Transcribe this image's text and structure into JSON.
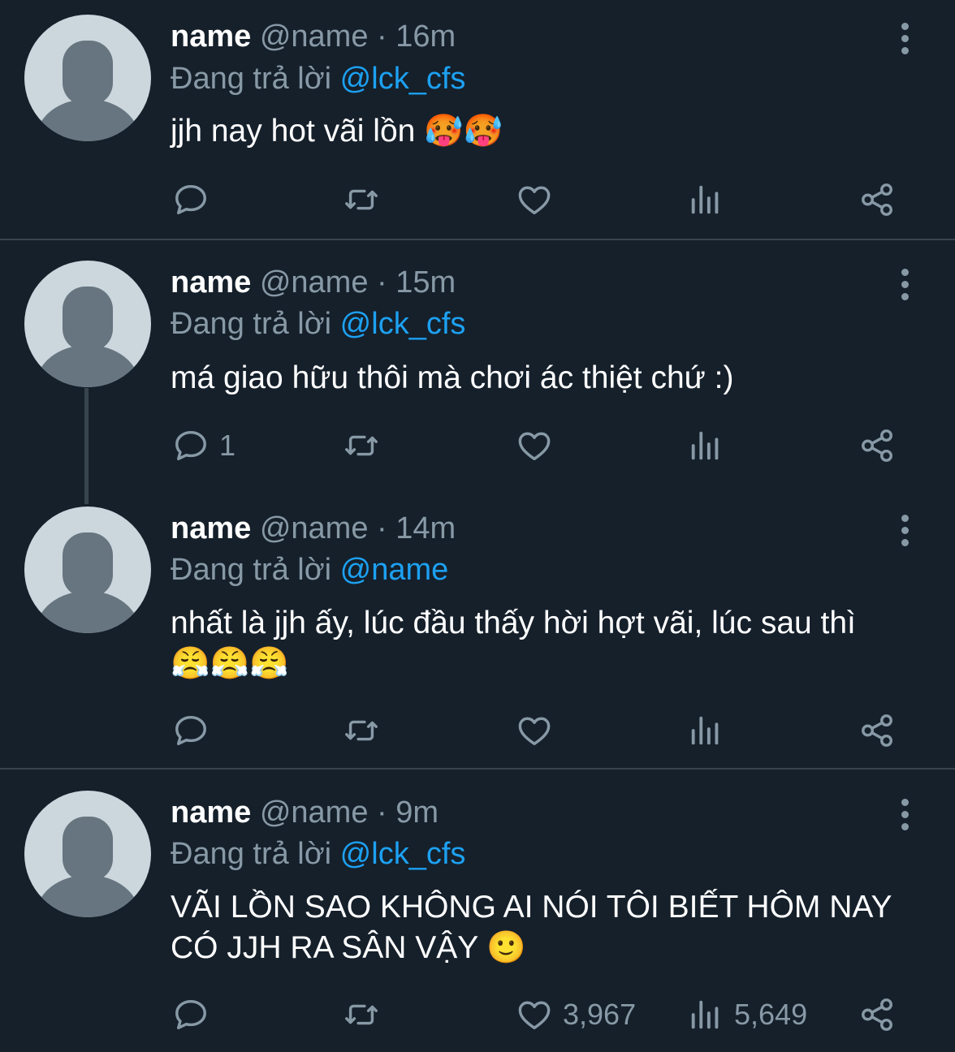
{
  "tweets": [
    {
      "name": "name",
      "handle": "@name",
      "dot": "·",
      "time": "16m",
      "reply_prefix": "Đang trả lời",
      "reply_to": "@lck_cfs",
      "text": "jjh nay hot vãi lồn 🥵🥵",
      "reply_count": "",
      "like_count": "",
      "view_count": ""
    },
    {
      "name": "name",
      "handle": "@name",
      "dot": "·",
      "time": "15m",
      "reply_prefix": "Đang trả lời",
      "reply_to": "@lck_cfs",
      "text": "má giao hữu thôi mà chơi ác thiệt chứ :)",
      "reply_count": "1",
      "like_count": "",
      "view_count": ""
    },
    {
      "name": "name",
      "handle": "@name",
      "dot": "·",
      "time": "14m",
      "reply_prefix": "Đang trả lời",
      "reply_to": "@name",
      "text": "nhất là jjh ấy, lúc đầu thấy hời hợt vãi, lúc sau thì 😤😤😤",
      "reply_count": "",
      "like_count": "",
      "view_count": ""
    },
    {
      "name": "name",
      "handle": "@name",
      "dot": "·",
      "time": "9m",
      "reply_prefix": "Đang trả lời",
      "reply_to": "@lck_cfs",
      "text": "VÃI LỒN SAO KHÔNG AI NÓI TÔI BIẾT HÔM NAY CÓ JJH RA SÂN VẬY 🙂",
      "reply_count": "",
      "like_count": "3,967",
      "view_count": "5,649"
    }
  ],
  "icons": {
    "avatar": "default-avatar-icon",
    "more": "more-vertical-icon",
    "reply": "reply-icon",
    "retweet": "retweet-icon",
    "like": "heart-icon",
    "views": "views-icon",
    "share": "share-icon"
  },
  "colors": {
    "background": "#15202b",
    "text": "#ffffff",
    "muted": "#8899a6",
    "accent": "#1da1f2",
    "divider": "#38444d",
    "avatar_bg": "#ccd6dd",
    "avatar_fg": "#66757f"
  }
}
